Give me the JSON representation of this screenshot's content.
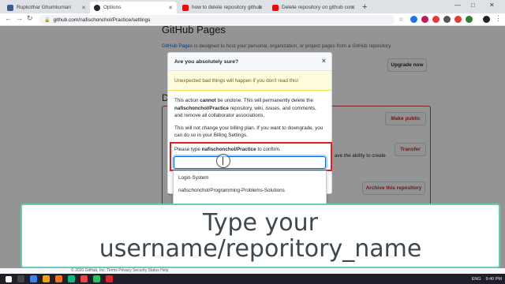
{
  "browser": {
    "tabs": [
      {
        "label": "Rupkothar Ghumkumari",
        "favicon_color": "#3b5998"
      },
      {
        "label": "Options",
        "favicon_color": "#24292e"
      },
      {
        "label": "how to delete repository github",
        "favicon_color": "#ff0000"
      },
      {
        "label": "Delete repository on github com",
        "favicon_color": "#ff0000"
      }
    ],
    "new_tab": "+",
    "url": "github.com/nafischonchol/Practice/settings",
    "window_controls": [
      "—",
      "□",
      "✕"
    ]
  },
  "page": {
    "section_title": "GitHub Pages",
    "description_link": "GitHub Pages",
    "description_rest": " is designed to host your personal, organization, or project pages from a GitHub repository.",
    "upgrade_button": "Upgrade now",
    "danger_letter": "D",
    "make_public_button": "Make public",
    "transfer_button": "Transfer",
    "transfer_side_text": "ave the ability to create",
    "archive_button": "Archive this repository",
    "side_m": "M"
  },
  "modal": {
    "title": "Are you absolutely sure?",
    "close": "×",
    "warning": "Unexpected bad things will happen if you don't read this!",
    "p1_pre": "This action ",
    "p1_strong": "cannot",
    "p1_mid": " be undone. This will permanently delete the ",
    "p1_repo": "nafischonchol/Practice",
    "p1_post": " repository, wiki, issues, and comments, and remove all collaborator associations.",
    "p2": "This will not change your billing plan. If you want to downgrade, you can do so in your Billing Settings.",
    "confirm_pre": "Please type ",
    "confirm_repo": "nafischonchol/Practice",
    "confirm_post": " to confirm.",
    "input_value": ""
  },
  "autocomplete": [
    "Login-System",
    "nafischonchol/Programming-Problems-Solutions"
  ],
  "caption": {
    "line1": "Type your",
    "line2": "username/reporitory_name"
  },
  "footer": "© 2020 GitHub, Inc.   Terms   Privacy   Security   Status   Help",
  "taskbar": {
    "language": "ENG",
    "time": "9:40 PM"
  }
}
